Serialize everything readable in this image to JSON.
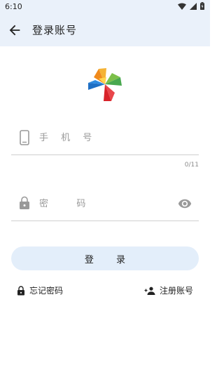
{
  "status_bar": {
    "time": "6:10"
  },
  "app_bar": {
    "title": "登录账号"
  },
  "form": {
    "phone_placeholder": "手 机 号",
    "phone_counter": "0/11",
    "password_placeholder": "密   码"
  },
  "actions": {
    "login_label": "登 录",
    "forgot_label": "忘记密码",
    "register_label": "注册账号"
  },
  "colors": {
    "app_bar_bg": "#eaf1fa",
    "button_bg": "#e3eefa"
  },
  "icons": [
    "back-arrow-icon",
    "logo-icon",
    "phone-icon",
    "lock-icon",
    "eye-icon",
    "person-add-icon"
  ]
}
